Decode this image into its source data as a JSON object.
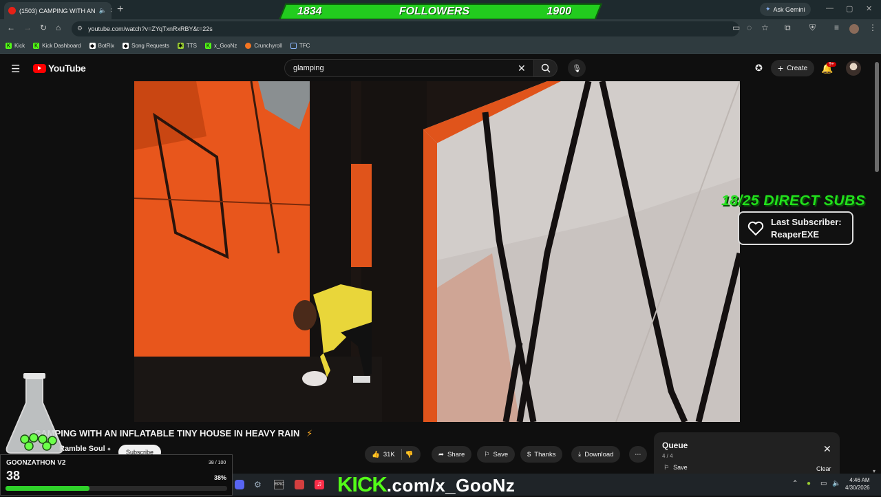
{
  "browser": {
    "tab_title": "(1503) CAMPING WITH AN",
    "new_tab": "+",
    "url": "youtube.com/watch?v=ZYqTxnRxRBY&t=22s",
    "ask_gemini": "Ask Gemini",
    "bookmarks": [
      "Kick",
      "Kick Dashboard",
      "BotRix",
      "Song Requests",
      "TTS",
      "x_GooNz",
      "Crunchyroll",
      "TFC"
    ]
  },
  "followers_bar": {
    "current": "1834",
    "label": "FOLLOWERS",
    "goal": "1900"
  },
  "youtube": {
    "logo_text": "YouTube",
    "search_value": "glamping",
    "create_label": "Create",
    "notif_badge": "9+"
  },
  "overlay": {
    "subs_goal": "18/25 DIRECT SUBS",
    "last_sub_label": "Last Subscriber:",
    "last_sub_name": "ReaperEXE"
  },
  "video": {
    "title": "CAMPING WITH AN INFLATABLE TINY HOUSE IN HEAVY RAIN",
    "channel": "Ramble Soul",
    "subscribe": "Subscribe",
    "likes": "31K",
    "share": "Share",
    "save": "Save",
    "thanks": "Thanks",
    "download": "Download"
  },
  "queue": {
    "title": "Queue",
    "count": "4 / 4",
    "save": "Save",
    "clear": "Clear"
  },
  "goonzathon": {
    "title": "GOONZATHON V2",
    "value": "38",
    "ratio": "38 / 100",
    "percent": "38%",
    "progress": 0.38
  },
  "stream_url": {
    "kick": "KICK",
    "rest": ".com/x_GooNz"
  },
  "clock": {
    "time": "4:46 AM",
    "date": "4/30/2026"
  },
  "colors": {
    "accent_green": "#22cc1e",
    "kick_green": "#53fc18",
    "yt_red": "#ff0000",
    "tent_orange": "#e8561c"
  }
}
